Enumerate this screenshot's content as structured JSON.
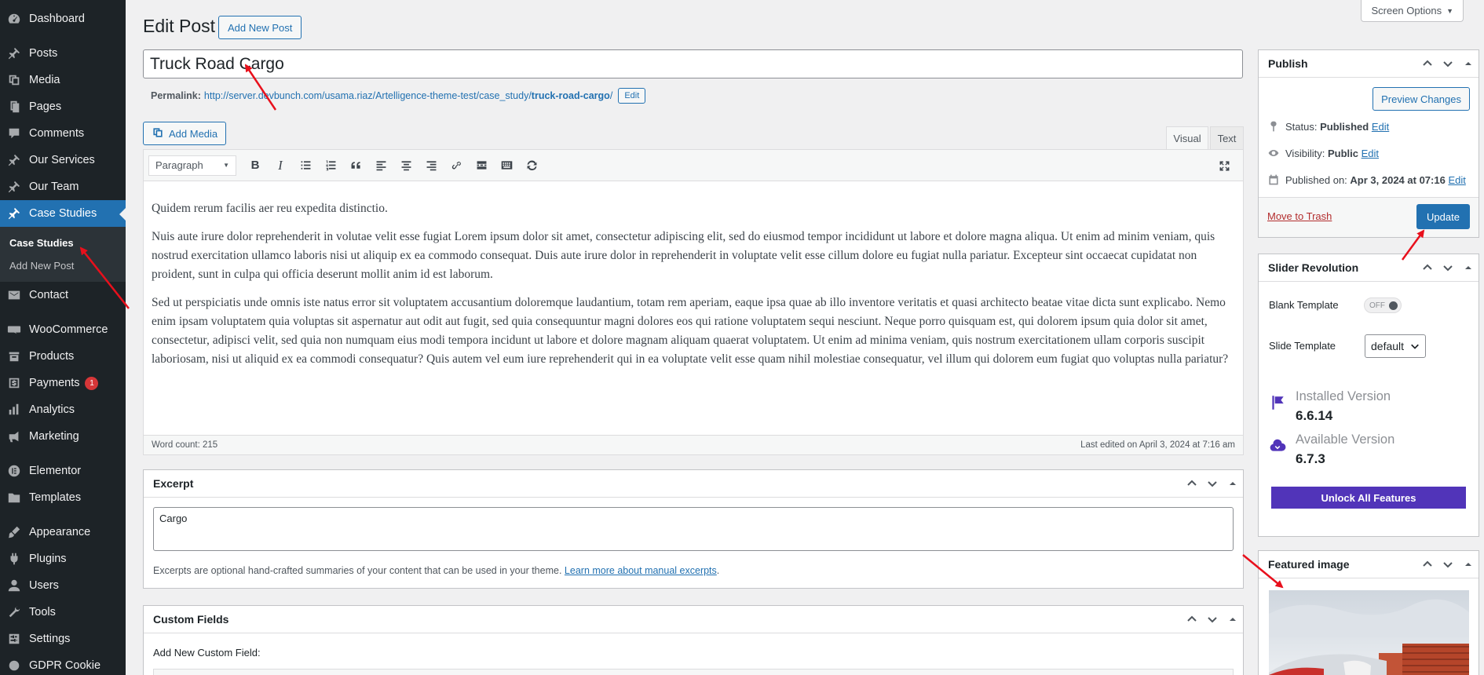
{
  "sidebar": {
    "items": [
      {
        "label": "Dashboard",
        "icon": "dashboard-icon"
      },
      {
        "label": "Posts",
        "icon": "pin-icon"
      },
      {
        "label": "Media",
        "icon": "media-icon"
      },
      {
        "label": "Pages",
        "icon": "pages-icon"
      },
      {
        "label": "Comments",
        "icon": "comments-icon"
      },
      {
        "label": "Our Services",
        "icon": "pin-icon"
      },
      {
        "label": "Our Team",
        "icon": "pin-icon"
      },
      {
        "label": "Case Studies",
        "icon": "pin-icon"
      },
      {
        "label": "Contact",
        "icon": "email-icon"
      },
      {
        "label": "WooCommerce",
        "icon": "woocommerce-icon"
      },
      {
        "label": "Products",
        "icon": "products-icon"
      },
      {
        "label": "Payments",
        "icon": "payments-icon",
        "badge": "1"
      },
      {
        "label": "Analytics",
        "icon": "analytics-icon"
      },
      {
        "label": "Marketing",
        "icon": "megaphone-icon"
      },
      {
        "label": "Elementor",
        "icon": "elementor-icon"
      },
      {
        "label": "Templates",
        "icon": "folder-icon"
      },
      {
        "label": "Appearance",
        "icon": "brush-icon"
      },
      {
        "label": "Plugins",
        "icon": "plugin-icon"
      },
      {
        "label": "Users",
        "icon": "users-icon"
      },
      {
        "label": "Tools",
        "icon": "wrench-icon"
      },
      {
        "label": "Settings",
        "icon": "settings-icon"
      },
      {
        "label": "GDPR Cookie",
        "icon": "cookie-icon"
      }
    ],
    "submenu": [
      "Case Studies",
      "Add New Post"
    ]
  },
  "header": {
    "screen_options": "Screen Options",
    "title": "Edit Post",
    "add_new": "Add New Post"
  },
  "post": {
    "title": "Truck Road Cargo",
    "permalink_label": "Permalink:",
    "permalink_base": "http://server.devbunch.com/usama.riaz/Artelligence-theme-test/case_study/",
    "permalink_slug": "truck-road-cargo",
    "permalink_end": "/",
    "permalink_edit": "Edit"
  },
  "editor": {
    "add_media": "Add Media",
    "tab_visual": "Visual",
    "tab_text": "Text",
    "format": "Paragraph",
    "paragraphs": [
      "Quidem rerum facilis aer reu expedita distinctio.",
      "Nuis aute irure dolor reprehenderit in volutae velit esse fugiat Lorem ipsum dolor sit amet, consectetur adipiscing elit, sed do eiusmod tempor incididunt ut labore et dolore magna aliqua. Ut enim ad minim veniam, quis nostrud exercitation ullamco laboris nisi ut aliquip ex ea commodo consequat. Duis aute irure dolor in reprehenderit in voluptate velit esse cillum dolore eu fugiat nulla pariatur. Excepteur sint occaecat cupidatat non proident, sunt in culpa qui officia deserunt mollit anim id est laborum.",
      "Sed ut perspiciatis unde omnis iste natus error sit voluptatem accusantium doloremque laudantium, totam rem aperiam, eaque ipsa quae ab illo inventore veritatis et quasi architecto beatae vitae dicta sunt explicabo. Nemo enim ipsam voluptatem quia voluptas sit aspernatur aut odit aut fugit, sed quia consequuntur magni dolores eos qui ratione voluptatem sequi nesciunt. Neque porro quisquam est, qui dolorem ipsum quia dolor sit amet, consectetur, adipisci velit, sed quia non numquam eius modi tempora incidunt ut labore et dolore magnam aliquam quaerat voluptatem. Ut enim ad minima veniam, quis nostrum exercitationem ullam corporis suscipit laboriosam, nisi ut aliquid ex ea commodi consequatur? Quis autem vel eum iure reprehenderit qui in ea voluptate velit esse quam nihil molestiae consequatur, vel illum qui dolorem eum fugiat quo voluptas nulla pariatur?"
    ],
    "word_count": "Word count: 215",
    "last_edited": "Last edited on April 3, 2024 at 7:16 am"
  },
  "excerpt": {
    "title": "Excerpt",
    "value": "Cargo",
    "help": "Excerpts are optional hand-crafted summaries of your content that can be used in your theme.",
    "help_link": "Learn more about manual excerpts",
    "help_end": "."
  },
  "custom_fields": {
    "title": "Custom Fields",
    "add_label": "Add New Custom Field:"
  },
  "publish": {
    "title": "Publish",
    "preview": "Preview Changes",
    "status_label": "Status:",
    "status_value": "Published",
    "visibility_label": "Visibility:",
    "visibility_value": "Public",
    "published_label": "Published on:",
    "published_value": "Apr 3, 2024 at 07:16",
    "edit": "Edit",
    "trash": "Move to Trash",
    "update": "Update"
  },
  "slider": {
    "title": "Slider Revolution",
    "blank_template": "Blank Template",
    "toggle": "OFF",
    "slide_template": "Slide Template",
    "slide_template_value": "default",
    "installed_label": "Installed Version",
    "installed_value": "6.6.14",
    "available_label": "Available Version",
    "available_value": "6.7.3",
    "unlock": "Unlock All Features"
  },
  "featured": {
    "title": "Featured image"
  },
  "colors": {
    "sidebar_bg": "#1d2327",
    "accent": "#2271b1",
    "annotation": "#e8101c",
    "slider_purple": "#5134b9"
  }
}
